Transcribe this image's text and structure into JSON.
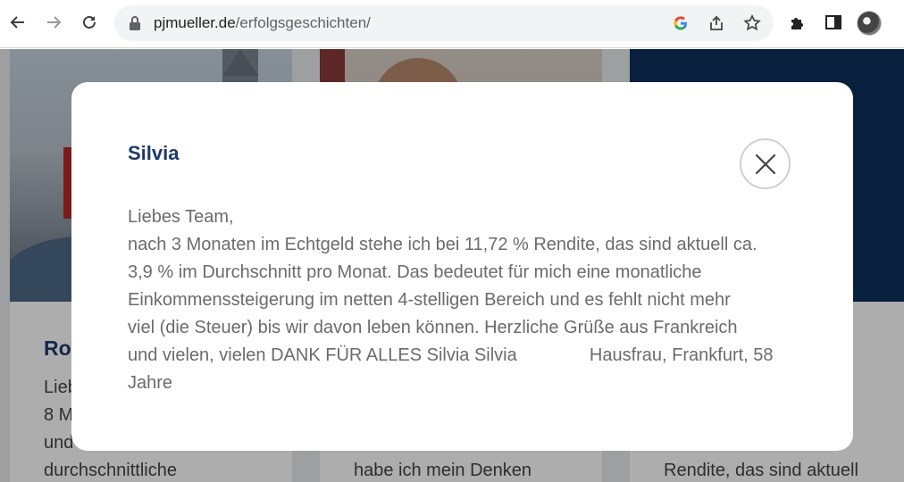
{
  "browser": {
    "url_host": "pjmueller.de",
    "url_path": "/erfolgsgeschichten/",
    "icons": [
      "back-arrow-icon",
      "forward-arrow-icon",
      "reload-icon",
      "lock-icon",
      "google-icon",
      "share-icon",
      "star-icon",
      "extensions-icon",
      "side-panel-icon",
      "profile-avatar",
      "menu-icon"
    ]
  },
  "background_cards": [
    {
      "name": "Rob",
      "lines": [
        "Lieb",
        "8 M",
        "und",
        "durchschnittliche"
      ]
    },
    {
      "lines": [
        "habe ich mein Denken"
      ]
    },
    {
      "lines": [
        "Rendite, das sind aktuell"
      ]
    }
  ],
  "modal": {
    "title": "Silvia",
    "close_label": "close",
    "lines": [
      "Liebes Team,",
      "nach 3 Monaten im Echtgeld stehe ich bei 11,72 % Rendite, das sind aktuell ca.",
      "3,9 % im Durchschnitt pro Monat. Das bedeutet für mich eine monatliche",
      "Einkommenssteigerung im netten 4-stelligen Bereich und es fehlt nicht mehr",
      "viel (die Steuer) bis wir davon leben können. Herzliche Grüße aus Frankreich"
    ],
    "line_6_before": "und vielen, vielen DANK FÜR ALLES Silvia Silvia",
    "line_6_after": "Hausfrau, Frankfurt, 58",
    "line_7": "Jahre"
  },
  "colors": {
    "title_blue": "#1f3a68",
    "card_dark_blue": "#0e2f5c",
    "body_text": "#6b6b6b"
  }
}
